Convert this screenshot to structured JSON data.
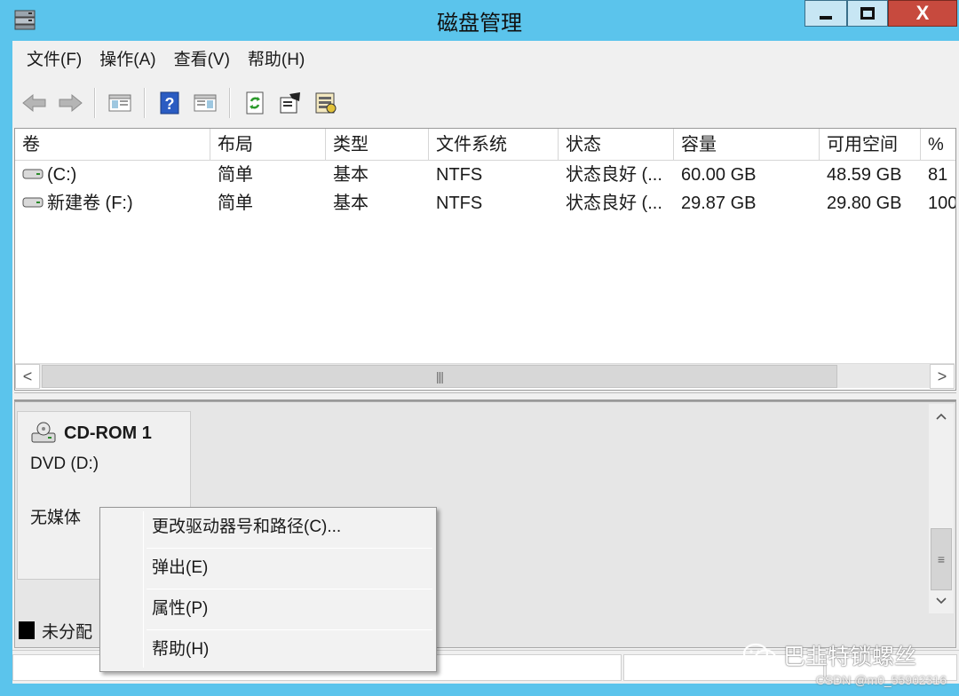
{
  "window": {
    "title": "磁盘管理",
    "close_label": "X",
    "accent_color": "#5bc4ec",
    "close_color": "#c74a3e"
  },
  "menubar": {
    "items": [
      "文件(F)",
      "操作(A)",
      "查看(V)",
      "帮助(H)"
    ]
  },
  "toolbar": {
    "buttons": [
      "back-arrow-icon",
      "forward-arrow-icon",
      "show-hide-console-tree-icon",
      "help-icon",
      "show-hide-action-pane-icon",
      "refresh-icon",
      "properties-icon",
      "rescan-disks-icon"
    ]
  },
  "volume_list": {
    "columns": [
      "卷",
      "布局",
      "类型",
      "文件系统",
      "状态",
      "容量",
      "可用空间",
      "% "
    ],
    "rows": [
      {
        "volume": "(C:)",
        "layout": "简单",
        "type": "基本",
        "fs": "NTFS",
        "status": "状态良好 (...",
        "capacity": "60.00 GB",
        "free": "48.59 GB",
        "pct": "81"
      },
      {
        "volume": "新建卷 (F:)",
        "layout": "简单",
        "type": "基本",
        "fs": "NTFS",
        "status": "状态良好 (...",
        "capacity": "29.87 GB",
        "free": "29.80 GB",
        "pct": "100"
      }
    ],
    "scroll_thumb_glyph": "|||",
    "scroll_left": "<",
    "scroll_right": ">"
  },
  "disk_panel": {
    "disk_name": "CD-ROM 1",
    "disk_sub": "DVD (D:)",
    "disk_status": "无媒体",
    "legend_label": "未分配",
    "vscroll_thumb_glyph": "≡"
  },
  "context_menu": {
    "items": [
      "更改驱动器号和路径(C)...",
      "弹出(E)",
      "属性(P)",
      "帮助(H)"
    ]
  },
  "watermark": {
    "wechat": "巴韭特锁螺丝",
    "csdn": "CSDN @m0_55902316"
  }
}
